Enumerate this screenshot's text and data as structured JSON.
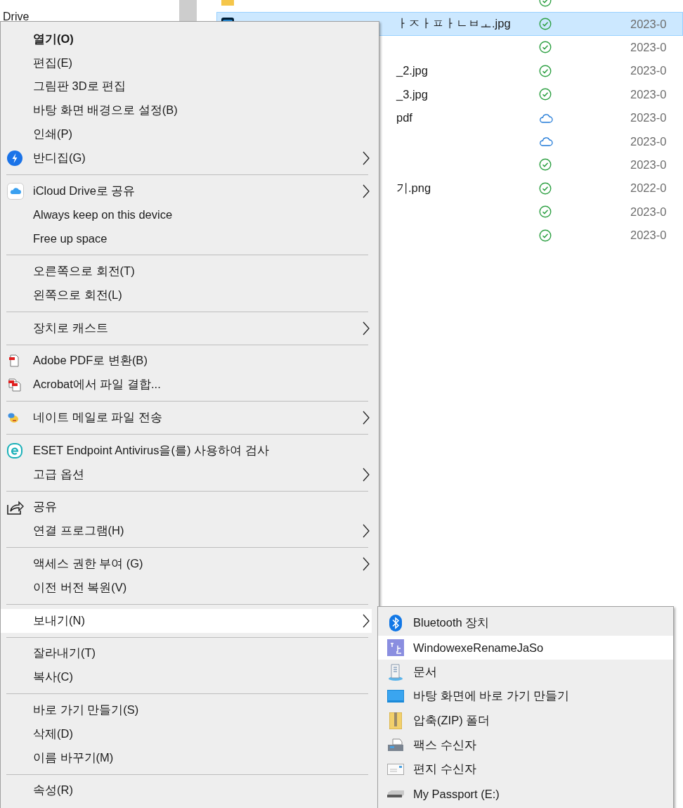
{
  "nav_pane": {
    "label": "Drive"
  },
  "files": [
    {
      "kind": "folder",
      "available_offline": true,
      "selected": false
    },
    {
      "kind": "photoshop",
      "name": "ㅏㅈㅏㅍㅏㄴㅂㅗ.jpg",
      "available_offline": true,
      "date": "2023-0",
      "selected": true
    },
    {
      "available_offline": true,
      "date": "2023-0",
      "selected": false
    },
    {
      "name": "_2.jpg",
      "available_offline": true,
      "date": "2023-0",
      "selected": false
    },
    {
      "name": "_3.jpg",
      "available_offline": true,
      "date": "2023-0",
      "selected": false
    },
    {
      "name": "pdf",
      "available_offline": false,
      "date": "2023-0",
      "selected": false
    },
    {
      "available_offline": false,
      "date": "2023-0",
      "selected": false
    },
    {
      "available_offline": true,
      "date": "2023-0",
      "selected": false
    },
    {
      "name": "기.png",
      "available_offline": true,
      "date": "2022-0",
      "selected": false
    },
    {
      "available_offline": true,
      "date": "2023-0",
      "selected": false
    },
    {
      "available_offline": true,
      "date": "2023-0",
      "selected": false
    }
  ],
  "menu": {
    "groups": [
      {
        "items": [
          {
            "label": "열기(O)",
            "default": true,
            "submenu": false,
            "selected": false
          },
          {
            "label": "편집(E)",
            "default": false,
            "submenu": false,
            "selected": false
          },
          {
            "label": "그림판 3D로 편집",
            "default": false,
            "submenu": false,
            "selected": false
          },
          {
            "label": "바탕 화면 배경으로 설정(B)",
            "default": false,
            "submenu": false,
            "selected": false
          },
          {
            "label": "인쇄(P)",
            "default": false,
            "submenu": false,
            "selected": false
          },
          {
            "label": "반디집(G)",
            "default": false,
            "submenu": true,
            "selected": false
          }
        ]
      },
      {
        "items": [
          {
            "label": "iCloud Drive로 공유",
            "default": false,
            "submenu": true,
            "selected": false
          },
          {
            "label": "Always keep on this device",
            "default": false,
            "submenu": false,
            "selected": false
          },
          {
            "label": "Free up space",
            "default": false,
            "submenu": false,
            "selected": false
          }
        ]
      },
      {
        "items": [
          {
            "label": "오른쪽으로 회전(T)",
            "default": false,
            "submenu": false,
            "selected": false
          },
          {
            "label": "왼쪽으로 회전(L)",
            "default": false,
            "submenu": false,
            "selected": false
          }
        ]
      },
      {
        "items": [
          {
            "label": "장치로 캐스트",
            "default": false,
            "submenu": true,
            "selected": false
          }
        ]
      },
      {
        "items": [
          {
            "label": "Adobe PDF로 변환(B)",
            "default": false,
            "submenu": false,
            "selected": false
          },
          {
            "label": "Acrobat에서 파일 결합...",
            "default": false,
            "submenu": false,
            "selected": false
          }
        ]
      },
      {
        "items": [
          {
            "label": "네이트 메일로 파일 전송",
            "default": false,
            "submenu": true,
            "selected": false
          }
        ]
      },
      {
        "items": [
          {
            "label": "ESET Endpoint Antivirus을(를) 사용하여 검사",
            "default": false,
            "submenu": false,
            "selected": false
          },
          {
            "label": "고급 옵션",
            "default": false,
            "submenu": true,
            "selected": false
          }
        ]
      },
      {
        "items": [
          {
            "label": "공유",
            "default": false,
            "submenu": false,
            "selected": false
          },
          {
            "label": "연결 프로그램(H)",
            "default": false,
            "submenu": true,
            "selected": false
          }
        ]
      },
      {
        "items": [
          {
            "label": "액세스 권한 부여 (G)",
            "default": false,
            "submenu": true,
            "selected": false
          },
          {
            "label": "이전 버전 복원(V)",
            "default": false,
            "submenu": false,
            "selected": false
          }
        ]
      },
      {
        "items": [
          {
            "label": "보내기(N)",
            "default": false,
            "submenu": true,
            "selected": true
          }
        ]
      },
      {
        "items": [
          {
            "label": "잘라내기(T)",
            "default": false,
            "submenu": false,
            "selected": false
          },
          {
            "label": "복사(C)",
            "default": false,
            "submenu": false,
            "selected": false
          }
        ]
      },
      {
        "items": [
          {
            "label": "바로 가기 만들기(S)",
            "default": false,
            "submenu": false,
            "selected": false
          },
          {
            "label": "삭제(D)",
            "default": false,
            "submenu": false,
            "selected": false
          },
          {
            "label": "이름 바꾸기(M)",
            "default": false,
            "submenu": false,
            "selected": false
          }
        ]
      },
      {
        "items": [
          {
            "label": "속성(R)",
            "default": false,
            "submenu": false,
            "selected": false
          }
        ]
      }
    ]
  },
  "send_to_menu": {
    "items": [
      {
        "label": "Bluetooth 장치",
        "selected": false
      },
      {
        "label": "WindowexeRenameJaSo",
        "selected": true
      },
      {
        "label": "문서",
        "selected": false
      },
      {
        "label": "바탕 화면에 바로 가기 만들기",
        "selected": false
      },
      {
        "label": "압축(ZIP) 폴더",
        "selected": false
      },
      {
        "label": "팩스 수신자",
        "selected": false
      },
      {
        "label": "편지 수신자",
        "selected": false
      },
      {
        "label": "My Passport (E:)",
        "selected": false
      }
    ]
  }
}
